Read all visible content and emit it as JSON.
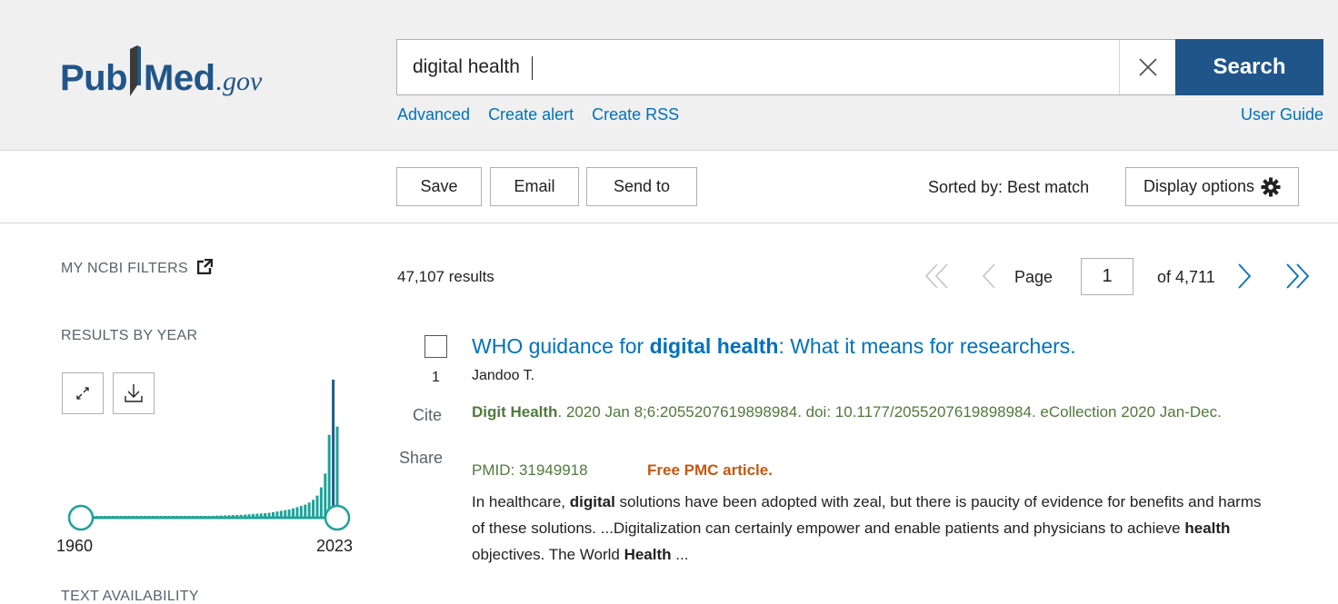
{
  "logo": {
    "pub": "Pub",
    "med": "Med",
    "gov": ".gov"
  },
  "search": {
    "value": "digital health",
    "button_label": "Search"
  },
  "links": {
    "advanced": "Advanced",
    "create_alert": "Create alert",
    "create_rss": "Create RSS",
    "user_guide": "User Guide"
  },
  "toolbar": {
    "save": "Save",
    "email": "Email",
    "send_to": "Send to",
    "sorted_by": "Sorted by: Best match",
    "display_options": "Display options"
  },
  "sidebar": {
    "my_ncbi_filters": "MY NCBI FILTERS",
    "results_by_year": "RESULTS BY YEAR",
    "year_start": "1960",
    "year_end": "2023",
    "text_availability": "TEXT AVAILABILITY"
  },
  "results": {
    "count": "47,107 results",
    "page_word": "Page",
    "page_value": "1",
    "of_pages": "of 4,711"
  },
  "article": {
    "number": "1",
    "cite": "Cite",
    "share": "Share",
    "title_pre": "WHO guidance for ",
    "title_bold": "digital health",
    "title_post": ": What it means for researchers.",
    "authors": "Jandoo T.",
    "journal_name": "Digit Health",
    "journal_rest": ". 2020 Jan 8;6:2055207619898984. doi: 10.1177/2055207619898984. eCollection 2020 Jan-Dec.",
    "pmid": "PMID: 31949918",
    "free": "Free PMC article.",
    "snippet_1": "In healthcare, ",
    "snippet_b1": "digital",
    "snippet_2": " solutions have been adopted with zeal, but there is paucity of evidence for benefits and harms of these solutions. ...Digitalization can certainly empower and enable patients and physicians to achieve ",
    "snippet_b2": "health",
    "snippet_3": " objectives. The World ",
    "snippet_b3": "Health",
    "snippet_4": " ..."
  },
  "colors": {
    "brand": "#20558a",
    "link": "#0071bc",
    "journal": "#4f7a3b",
    "free": "#c5580f",
    "bars_teal": "#20a29a",
    "bar_highlight": "#205c8a"
  },
  "icons": [
    "external-link-icon",
    "expand-icon",
    "download-icon",
    "close-icon",
    "gear-icon",
    "first-page-icon",
    "prev-page-icon",
    "next-page-icon",
    "last-page-icon"
  ],
  "year_histogram": {
    "start_year": 1960,
    "end_year": 2023,
    "relative_counts": [
      0.01,
      0.01,
      0.01,
      0.01,
      0.01,
      0.01,
      0.01,
      0.01,
      0.01,
      0.01,
      0.01,
      0.01,
      0.01,
      0.01,
      0.01,
      0.01,
      0.01,
      0.01,
      0.01,
      0.01,
      0.01,
      0.01,
      0.01,
      0.01,
      0.01,
      0.01,
      0.01,
      0.01,
      0.01,
      0.01,
      0.012,
      0.012,
      0.013,
      0.014,
      0.015,
      0.016,
      0.017,
      0.018,
      0.019,
      0.02,
      0.021,
      0.023,
      0.025,
      0.027,
      0.029,
      0.031,
      0.033,
      0.036,
      0.04,
      0.045,
      0.05,
      0.055,
      0.06,
      0.068,
      0.076,
      0.085,
      0.095,
      0.11,
      0.13,
      0.16,
      0.22,
      0.32,
      0.6,
      1.0,
      0.66
    ]
  }
}
